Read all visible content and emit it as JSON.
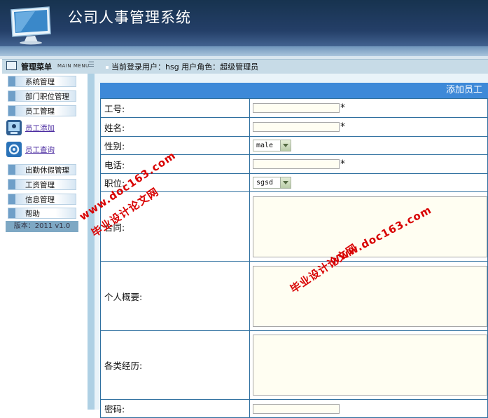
{
  "header": {
    "title": "公司人事管理系统"
  },
  "menubar": {
    "title": "管理菜单",
    "title_en": "MAIN MENU",
    "user_info": "当前登录用户：hsg   用户角色：超级管理员"
  },
  "sidebar": {
    "items": [
      {
        "label": "系统管理"
      },
      {
        "label": "部门职位管理"
      },
      {
        "label": "员工管理"
      }
    ],
    "sub_items": [
      {
        "label": "员工添加",
        "icon": "employee-add-icon"
      },
      {
        "label": "员工查询",
        "icon": "employee-search-icon"
      }
    ],
    "items2": [
      {
        "label": "出勤休假管理"
      },
      {
        "label": "工资管理"
      },
      {
        "label": "信息管理"
      },
      {
        "label": "帮助"
      }
    ],
    "version": "版本：2011  v1.0"
  },
  "form": {
    "title": "添加员工",
    "fields": {
      "id": {
        "label": "工号:",
        "value": "",
        "required_mark": "*"
      },
      "name": {
        "label": "姓名:",
        "value": "",
        "required_mark": "*"
      },
      "gender": {
        "label": "性别:",
        "selected": "male"
      },
      "phone": {
        "label": "电话:",
        "value": "",
        "required_mark": "*"
      },
      "position": {
        "label": "职位:",
        "selected": "sgsd"
      },
      "contract": {
        "label": "合同:",
        "value": ""
      },
      "profile": {
        "label": "个人概要:",
        "value": ""
      },
      "experience": {
        "label": "各类经历:",
        "value": ""
      },
      "password": {
        "label": "密码:",
        "value": ""
      }
    }
  },
  "watermark": {
    "site": "www.doc163.com",
    "cn": "毕业设计论文网",
    "color": "#d80000"
  },
  "colors": {
    "header": "#243f68",
    "form_title": "#3d89d8",
    "border": "#2e6f9f"
  }
}
